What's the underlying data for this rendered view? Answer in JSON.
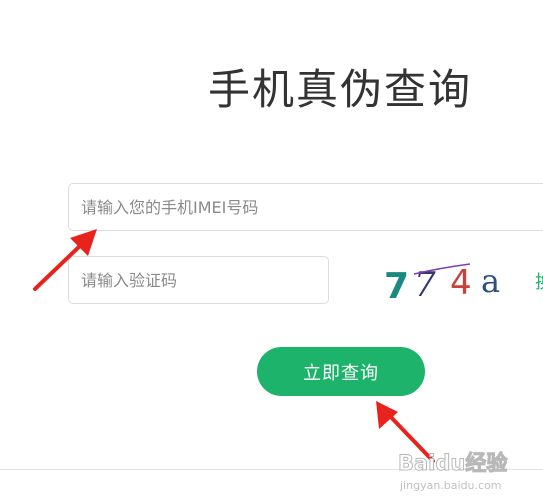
{
  "page": {
    "title": "手机真伪查询"
  },
  "form": {
    "imei_placeholder": "请输入您的手机IMEI号码",
    "imei_value": "",
    "captcha_placeholder": "请输入验证码",
    "captcha_value": "",
    "captcha_text": "774a",
    "captcha_chars": [
      {
        "char": "7",
        "color": "#1a8a7e"
      },
      {
        "char": "7",
        "color": "#333a6a"
      },
      {
        "char": "4",
        "color": "#c8423a"
      },
      {
        "char": "a",
        "color": "#2b4f7e"
      }
    ],
    "refresh_label": "换",
    "submit_label": "立即查询"
  },
  "colors": {
    "accent": "#1db36b",
    "annotation_arrow": "#e8231c"
  },
  "watermark": {
    "brand": "Baidu经验",
    "url": "jingyan.baidu.com"
  }
}
